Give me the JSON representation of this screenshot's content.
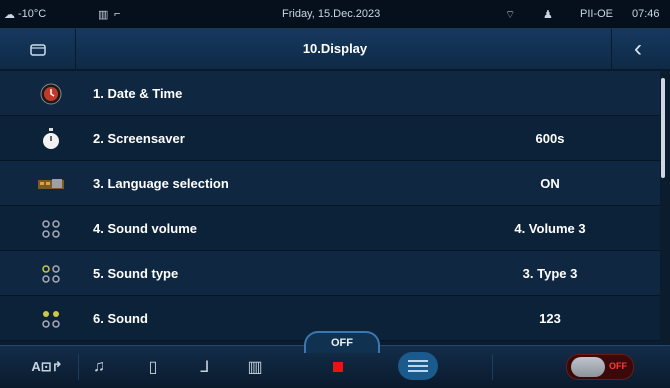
{
  "status": {
    "temperature": "-10°C",
    "date": "Friday, 15.Dec.2023",
    "profile": "PII-OE",
    "time": "07:46"
  },
  "header": {
    "title": "10.Display"
  },
  "items": [
    {
      "label": "1. Date & Time",
      "value": "",
      "icon": "clock-icon"
    },
    {
      "label": "2. Screensaver",
      "value": "600s",
      "icon": "stopwatch-icon"
    },
    {
      "label": "3. Language selection",
      "value": "ON",
      "icon": "keyboard-icon"
    },
    {
      "label": "4. Sound volume",
      "value": "4. Volume 3",
      "icon": "speaker-dots-icon"
    },
    {
      "label": "5. Sound type",
      "value": "3. Type 3",
      "icon": "speaker-dots-icon"
    },
    {
      "label": "6. Sound",
      "value": "123",
      "icon": "speaker-dots-icon"
    }
  ],
  "footer": {
    "off_label": "OFF",
    "toggle_label": "OFF"
  }
}
